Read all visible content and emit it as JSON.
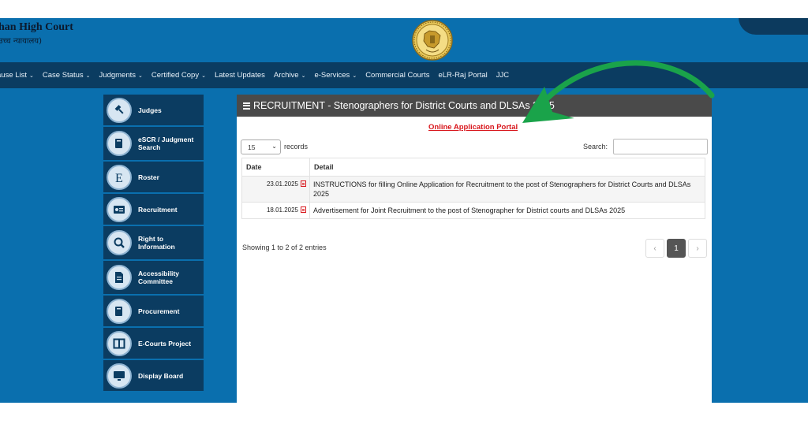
{
  "header": {
    "court_name": "han High Court",
    "court_name_hindi": "उच्च न्यायालय)",
    "emblem_icon": "court-emblem-icon"
  },
  "nav": {
    "items": [
      {
        "label": "ause List",
        "dropdown": true
      },
      {
        "label": "Case Status",
        "dropdown": true
      },
      {
        "label": "Judgments",
        "dropdown": true
      },
      {
        "label": "Certified Copy",
        "dropdown": true
      },
      {
        "label": "Latest Updates",
        "dropdown": false
      },
      {
        "label": "Archive",
        "dropdown": true
      },
      {
        "label": "e-Services",
        "dropdown": true
      },
      {
        "label": "Commercial Courts",
        "dropdown": false
      },
      {
        "label": "eLR-Raj Portal",
        "dropdown": false
      },
      {
        "label": "JJC",
        "dropdown": false
      }
    ]
  },
  "sidebar": {
    "items": [
      {
        "label": "Judges",
        "icon": "gavel-icon"
      },
      {
        "label": "eSCR / Judgment Search",
        "icon": "book-icon"
      },
      {
        "label": "Roster",
        "icon": "letter-e-icon"
      },
      {
        "label": "Recruitment",
        "icon": "id-card-icon"
      },
      {
        "label": "Right to Information",
        "icon": "search-icon"
      },
      {
        "label": "Accessibility Committee",
        "icon": "document-icon"
      },
      {
        "label": "Procurement",
        "icon": "book-icon"
      },
      {
        "label": "E-Courts Project",
        "icon": "columns-icon"
      },
      {
        "label": "Display Board",
        "icon": "monitor-icon"
      }
    ]
  },
  "panel": {
    "title": "RECRUITMENT - Stenographers for District Courts and DLSAs 2025",
    "portal_link": "Online Application Portal",
    "length_value": "15",
    "records_label": "records",
    "search_label": "Search:",
    "search_value": "",
    "columns": [
      "Date",
      "Detail"
    ],
    "rows": [
      {
        "date": "23.01.2025",
        "detail": "INSTRUCTIONS for filling Online Application for Recruitment to the post of Stenographers for District Courts and DLSAs 2025"
      },
      {
        "date": "18.01.2025",
        "detail": "Advertisement for Joint Recruitment to the post of Stenographer for District courts and DLSAs 2025"
      }
    ],
    "showing": "Showing 1 to 2 of 2 entries",
    "pager": {
      "prev": "‹",
      "current": "1",
      "next": "›"
    }
  },
  "colors": {
    "site_blue": "#0a6fae",
    "nav_dark": "#0b3c61",
    "panel_header": "#4a4a4a",
    "link_red": "#d8161c",
    "annotation_arrow": "#1aa34a"
  }
}
